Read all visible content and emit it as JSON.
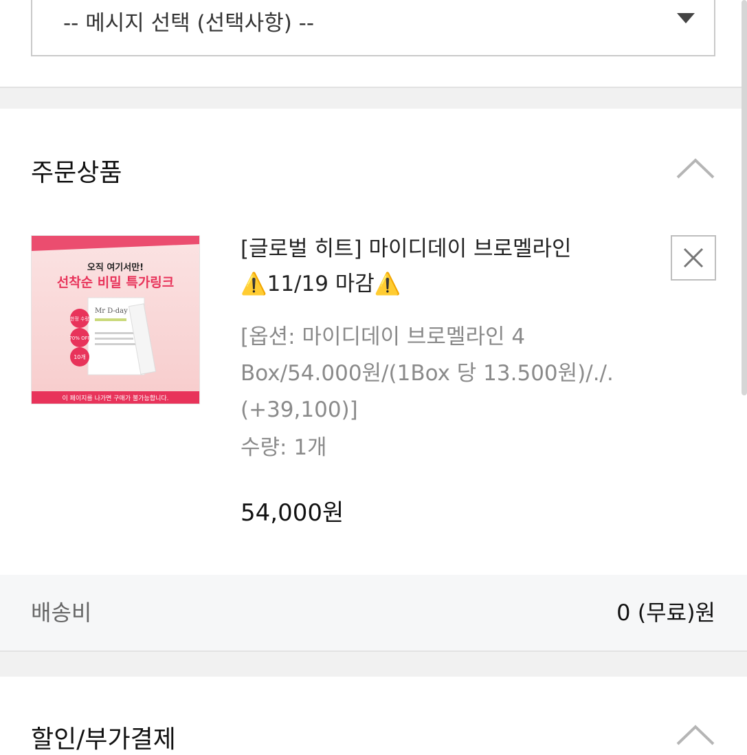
{
  "message_select": {
    "selected": "-- 메시지 선택 (선택사항) --",
    "arrow_icon": "caret-down-icon"
  },
  "order_section": {
    "title": "주문상품",
    "toggle_icon": "chevron-up-icon",
    "product": {
      "image_alt": "마이디데이 브로멜라인 상품 이미지",
      "image_text": {
        "line1": "오직 여기서만!",
        "line2": "선착순 비밀 특가링크",
        "badges": [
          "한정 수량",
          "70% OFF",
          "10개"
        ],
        "brand": "Mr D-day",
        "footer": "이 페이지를 나가면 구매가 불가능합니다."
      },
      "name_line1": "[글로벌 히트] 마이디데이 브로멜라인",
      "name_line2": "⚠️11/19 마감⚠️",
      "option_line1": "[옵션: 마이디데이 브로멜라인 4",
      "option_line2": "Box/54.000원/(1Box 당 13.500원)/./.",
      "option_line3": "(+39,100)]",
      "quantity": "수량: 1개",
      "price": "54,000원",
      "remove_icon": "close-icon"
    }
  },
  "shipping": {
    "label": "배송비",
    "value": "0 (무료)원"
  },
  "discount_section": {
    "title": "할인/부가결제",
    "toggle_icon": "chevron-up-icon"
  },
  "colors": {
    "band": "#f1f1f1",
    "border": "#c9c9c9",
    "muted_text": "#8a8a8a",
    "promo_pink": "#e8335a"
  }
}
